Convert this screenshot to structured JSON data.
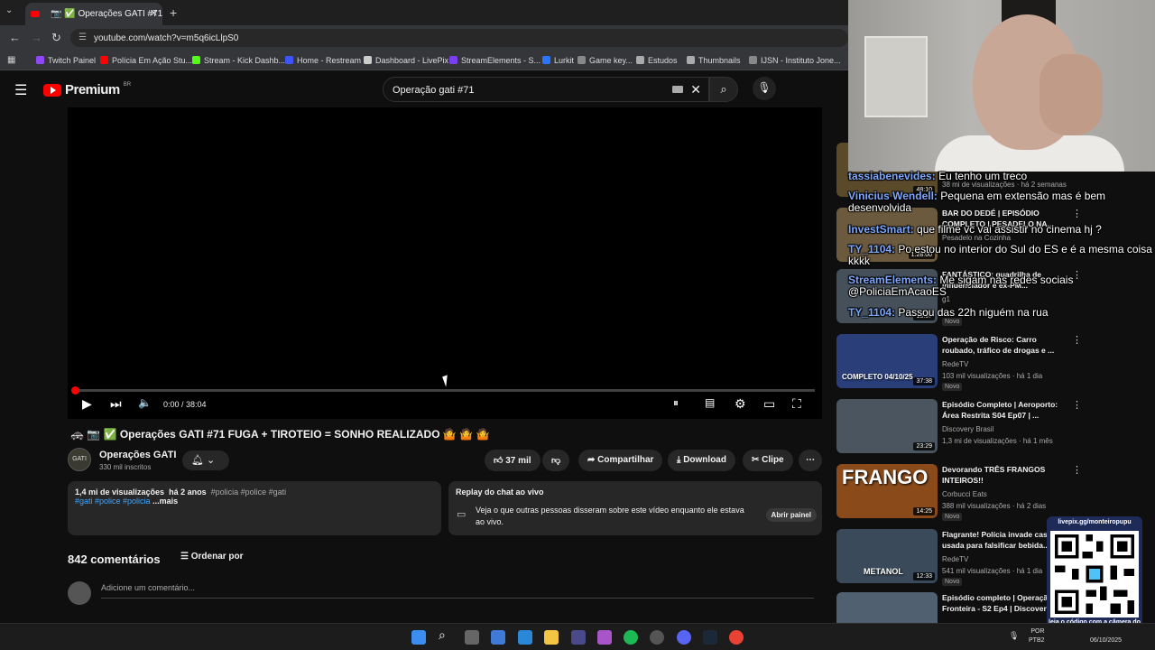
{
  "browser": {
    "tab_title": "📷 ✅ Operações GATI #71 F",
    "url": "youtube.com/watch?v=m5q6icLlpS0",
    "bookmarks": [
      {
        "label": "Twitch Painel",
        "color": "#9146ff"
      },
      {
        "label": "Polícia Em Ação Stu...",
        "color": "#ff0000"
      },
      {
        "label": "Stream - Kick Dashb...",
        "color": "#53fc18"
      },
      {
        "label": "Home - Restream",
        "color": "#3c55ff"
      },
      {
        "label": "Dashboard - LivePix",
        "color": "#cccccc"
      },
      {
        "label": "StreamElements - S...",
        "color": "#7b3ff2"
      },
      {
        "label": "Lurkit",
        "color": "#2a75ff"
      },
      {
        "label": "Game key...",
        "color": "#888888"
      },
      {
        "label": "Estudos",
        "color": "#aaaaaa"
      },
      {
        "label": "Thumbnails",
        "color": "#aaaaaa"
      },
      {
        "label": "IJSN - Instituto Jone...",
        "color": "#888888"
      }
    ]
  },
  "youtube": {
    "logo_text": "Premium",
    "logo_region": "BR",
    "search_query": "Operação gati #71",
    "player": {
      "time": "0:00 / 38:04"
    },
    "video_title": "🚓 📷 ✅ Operações GATI #71 FUGA + TIROTEIO = SONHO REALIZADO 🤷 🤷 🤷",
    "channel": {
      "name": "Operações GATI",
      "subs": "330 mil inscritos",
      "avatar_text": "GATI"
    },
    "actions": {
      "likes": "37 mil",
      "share": "Compartilhar",
      "download": "Download",
      "clip": "Clipe"
    },
    "description": {
      "views": "1,4 mi de visualizações",
      "age": "há 2 anos",
      "tags1": "#policia #police #gati",
      "tags2": "#gati #police #policia",
      "more": "...mais"
    },
    "replay": {
      "title": "Replay do chat ao vivo",
      "text": "Veja o que outras pessoas disseram sobre este vídeo enquanto ele estava ao vivo.",
      "button": "Abrir painel"
    },
    "comments": {
      "count": "842 comentários",
      "sort": "Ordenar por",
      "placeholder": "Adicione um comentário..."
    }
  },
  "recommendations": [
    {
      "title": "",
      "channel": "",
      "meta": "38 mi de visualizações · há 2 semanas",
      "duration": "48:10",
      "new": "",
      "thumb": "#5a4a2a",
      "cap": ""
    },
    {
      "title": "BAR DO DEDÉ | EPISÓDIO COMPLETO | PESADELO NA...",
      "channel": "Pesadelo na Cozinha",
      "meta": "",
      "duration": "1:28:00",
      "new": "",
      "thumb": "#6b5a3e",
      "cap": ""
    },
    {
      "title": "FANTÁSTICO: quadrilha de influenciador e ex-PM...",
      "channel": "g1",
      "meta": "",
      "duration": "13:57",
      "new": "Novo",
      "thumb": "#45505a",
      "cap": ""
    },
    {
      "title": "Operação de Risco: Carro roubado, tráfico de drogas e ...",
      "channel": "RedeTV",
      "meta": "103 mil visualizações · há 1 dia",
      "duration": "37:38",
      "new": "Novo",
      "thumb": "#2a3f7a",
      "cap": "COMPLETO 04/10/25"
    },
    {
      "title": "Episódio Completo | Aeroporto: Área Restrita S04 Ep07 | ...",
      "channel": "Discovery Brasil",
      "meta": "1,3 mi de visualizações · há 1 mês",
      "duration": "23:29",
      "new": "",
      "thumb": "#4a5560",
      "cap": ""
    },
    {
      "title": "Devorando TRÊS FRANGOS INTEIROS!!",
      "channel": "Corbucci Eats",
      "meta": "388 mil visualizações · há 2 dias",
      "duration": "14:25",
      "new": "Novo",
      "thumb": "#8a4a1a",
      "cap": "FRANGO"
    },
    {
      "title": "Flagrante! Polícia invade casa usada para falsificar bebida...",
      "channel": "RedeTV",
      "meta": "541 mil visualizações · há 1 dia",
      "duration": "12:33",
      "new": "Novo",
      "thumb": "#3a4a5a",
      "cap": "METANOL"
    },
    {
      "title": "Episódio completo | Operação Fronteira - S2 Ep4 | Discovery...",
      "channel": "Discovery Brasil",
      "meta": "",
      "duration": "",
      "new": "",
      "thumb": "#506070",
      "cap": ""
    }
  ],
  "chat": [
    {
      "user": "tassiabenevides:",
      "msg": "Eu tenho um treco"
    },
    {
      "user": "Vinicius Wendell:",
      "msg": "Pequena em extensão mas é bem desenvolvida"
    },
    {
      "user": "InvestSmart:",
      "msg": "que filme vc vai assistir no cinema hj ?"
    },
    {
      "user": "TY_1104:",
      "msg": "Po estou no interior do Sul do ES e é a mesma coisa kkkk"
    },
    {
      "user": "StreamElements:",
      "msg": "Me sigam nas redes sociais @PoliciaEmAcaoES"
    },
    {
      "user": "TY_1104:",
      "msg": "Passou das 22h niguém na rua"
    }
  ],
  "qr": {
    "url": "livepix.gg/monteiropupu",
    "caption": "leia o código com a câmera do celular."
  },
  "taskbar": {
    "lang1": "POR",
    "lang2": "PTB2",
    "date": "06/10/2025"
  }
}
